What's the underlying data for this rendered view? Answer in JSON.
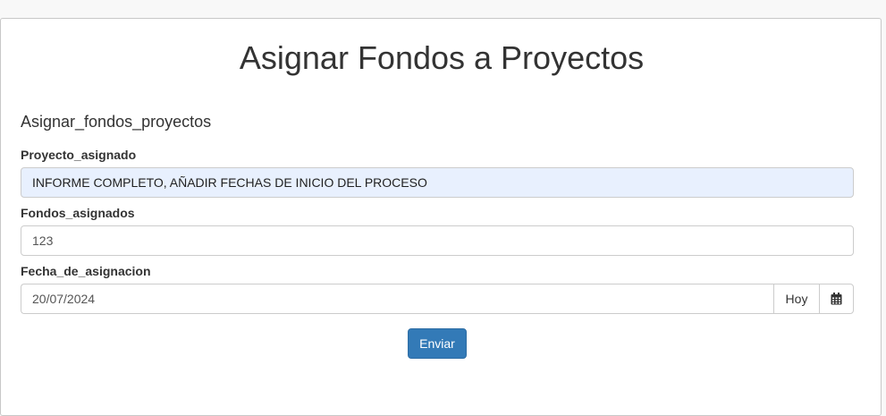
{
  "header": {
    "title": "Asignar Fondos a Proyectos"
  },
  "form": {
    "title": "Asignar_fondos_proyectos",
    "fields": {
      "proyecto": {
        "label": "Proyecto_asignado",
        "value": "INFORME COMPLETO, AÑADIR FECHAS DE INICIO DEL PROCESO"
      },
      "fondos": {
        "label": "Fondos_asignados",
        "value": "123"
      },
      "fecha": {
        "label": "Fecha_de_asignacion",
        "value": "20/07/2024",
        "today_label": "Hoy",
        "calendar_icon": "calendar-icon"
      }
    },
    "submit_label": "Enviar"
  },
  "colors": {
    "primary": "#337ab7",
    "autofill": "#e8f0fe"
  }
}
